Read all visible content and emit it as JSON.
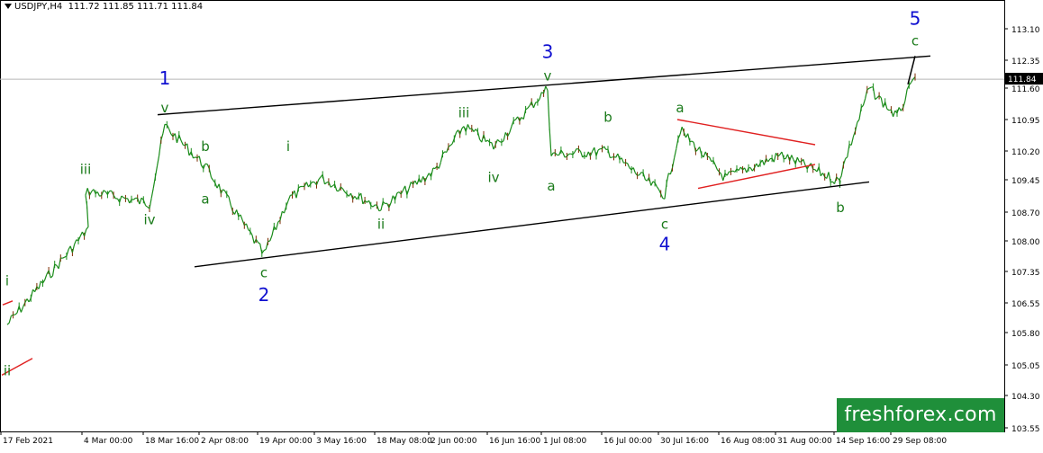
{
  "header": {
    "symbol": "USDJPY,H4",
    "ohlc": "111.72 111.85 111.71 111.84"
  },
  "watermark": "freshforex.com",
  "colors": {
    "background": "#ffffff",
    "candle": "#1a8c1a",
    "wave_major": "#1010d0",
    "wave_minor": "#1a7a1a",
    "channel": "#000000",
    "triangle": "#e02020",
    "watermark_bg": "#1f8f3a"
  },
  "chart_data": {
    "type": "line",
    "title": "USDJPY,H4",
    "x_ticks": [
      "17 Feb 2021",
      "4 Mar 00:00",
      "18 Mar 16:00",
      "2 Apr 08:00",
      "19 Apr 00:00",
      "3 May 16:00",
      "18 May 08:00",
      "2 Jun 00:00",
      "16 Jun 16:00",
      "1 Jul 08:00",
      "16 Jul 00:00",
      "30 Jul 16:00",
      "16 Aug 08:00",
      "31 Aug 00:00",
      "14 Sep 16:00",
      "29 Sep 08:00"
    ],
    "y_ticks": [
      "113.10",
      "112.35",
      "111.60",
      "110.95",
      "110.20",
      "109.45",
      "108.70",
      "108.00",
      "107.35",
      "106.55",
      "105.80",
      "105.05",
      "104.30",
      "103.55"
    ],
    "y_tick_values": [
      113.1,
      112.35,
      111.6,
      110.95,
      110.2,
      109.45,
      108.7,
      108.0,
      107.35,
      106.55,
      105.8,
      105.05,
      104.3,
      103.55
    ],
    "current_price": "111.84",
    "ylim": [
      103.4,
      113.6
    ],
    "price_path": [
      {
        "x": "17 Feb 2021",
        "y": 106.0
      },
      {
        "x": "4 Mar 00:00",
        "y": 108.3
      },
      {
        "x": "4 Mar 12:00",
        "y": 109.2
      },
      {
        "x": "18 Mar 16:00",
        "y": 108.9
      },
      {
        "x": "26 Mar 00:00",
        "y": 110.8
      },
      {
        "x": "2 Apr 08:00",
        "y": 109.8
      },
      {
        "x": "19 Apr 00:00",
        "y": 107.7
      },
      {
        "x": "26 Apr 00:00",
        "y": 109.0
      },
      {
        "x": "3 May 16:00",
        "y": 109.5
      },
      {
        "x": "18 May 08:00",
        "y": 108.8
      },
      {
        "x": "2 Jun 00:00",
        "y": 109.7
      },
      {
        "x": "12 Jun 00:00",
        "y": 110.8
      },
      {
        "x": "16 Jun 16:00",
        "y": 110.3
      },
      {
        "x": "1 Jul 08:00",
        "y": 111.6
      },
      {
        "x": "7 Jul 00:00",
        "y": 110.1
      },
      {
        "x": "16 Jul 00:00",
        "y": 110.2
      },
      {
        "x": "30 Jul 16:00",
        "y": 109.1
      },
      {
        "x": "6 Aug 00:00",
        "y": 110.7
      },
      {
        "x": "16 Aug 08:00",
        "y": 109.5
      },
      {
        "x": "31 Aug 00:00",
        "y": 110.1
      },
      {
        "x": "14 Sep 16:00",
        "y": 109.4
      },
      {
        "x": "20 Sep 00:00",
        "y": 109.5
      },
      {
        "x": "25 Sep 00:00",
        "y": 111.6
      },
      {
        "x": "29 Sep 08:00",
        "y": 111.0
      },
      {
        "x": "4 Oct 00:00",
        "y": 111.9
      }
    ],
    "wave_labels_major": [
      "1",
      "2",
      "3",
      "4",
      "5"
    ],
    "wave_labels_minor": [
      "i",
      "ii",
      "iii",
      "iv",
      "v",
      "a",
      "b",
      "c"
    ],
    "annotations": [
      {
        "text": "1",
        "x": "26 Mar 00:00",
        "y": 111.7
      },
      {
        "text": "v",
        "x": "26 Mar 00:00",
        "y": 111.1
      },
      {
        "text": "iii",
        "x": "4 Mar 12:00",
        "y": 109.6
      },
      {
        "text": "iv",
        "x": "18 Mar 16:00",
        "y": 108.4
      },
      {
        "text": "b",
        "x": "2 Apr 08:00",
        "y": 110.2
      },
      {
        "text": "a",
        "x": "2 Apr 08:00",
        "y": 108.9
      },
      {
        "text": "c",
        "x": "19 Apr 00:00",
        "y": 107.2
      },
      {
        "text": "2",
        "x": "19 Apr 00:00",
        "y": 106.6
      },
      {
        "text": "i",
        "x": "26 Apr 00:00",
        "y": 110.2
      },
      {
        "text": "ii",
        "x": "18 May 08:00",
        "y": 108.3
      },
      {
        "text": "iii",
        "x": "12 Jun 00:00",
        "y": 111.0
      },
      {
        "text": "iv",
        "x": "16 Jun 16:00",
        "y": 109.4
      },
      {
        "text": "3",
        "x": "1 Jul 08:00",
        "y": 112.4
      },
      {
        "text": "v",
        "x": "1 Jul 08:00",
        "y": 111.8
      },
      {
        "text": "a",
        "x": "7 Jul 00:00",
        "y": 109.2
      },
      {
        "text": "b",
        "x": "16 Jul 00:00",
        "y": 110.9
      },
      {
        "text": "c",
        "x": "30 Jul 16:00",
        "y": 108.3
      },
      {
        "text": "4",
        "x": "30 Jul 16:00",
        "y": 107.8
      },
      {
        "text": "a",
        "x": "6 Aug 00:00",
        "y": 111.1
      },
      {
        "text": "b",
        "x": "14 Sep 16:00",
        "y": 108.7
      },
      {
        "text": "5",
        "x": "4 Oct 00:00",
        "y": 113.2
      },
      {
        "text": "c",
        "x": "4 Oct 00:00",
        "y": 112.7
      },
      {
        "text": "i",
        "x": "17 Feb 2021",
        "y": 107.0
      },
      {
        "text": "ii",
        "x": "17 Feb 2021",
        "y": 104.8
      }
    ],
    "grid": false
  }
}
